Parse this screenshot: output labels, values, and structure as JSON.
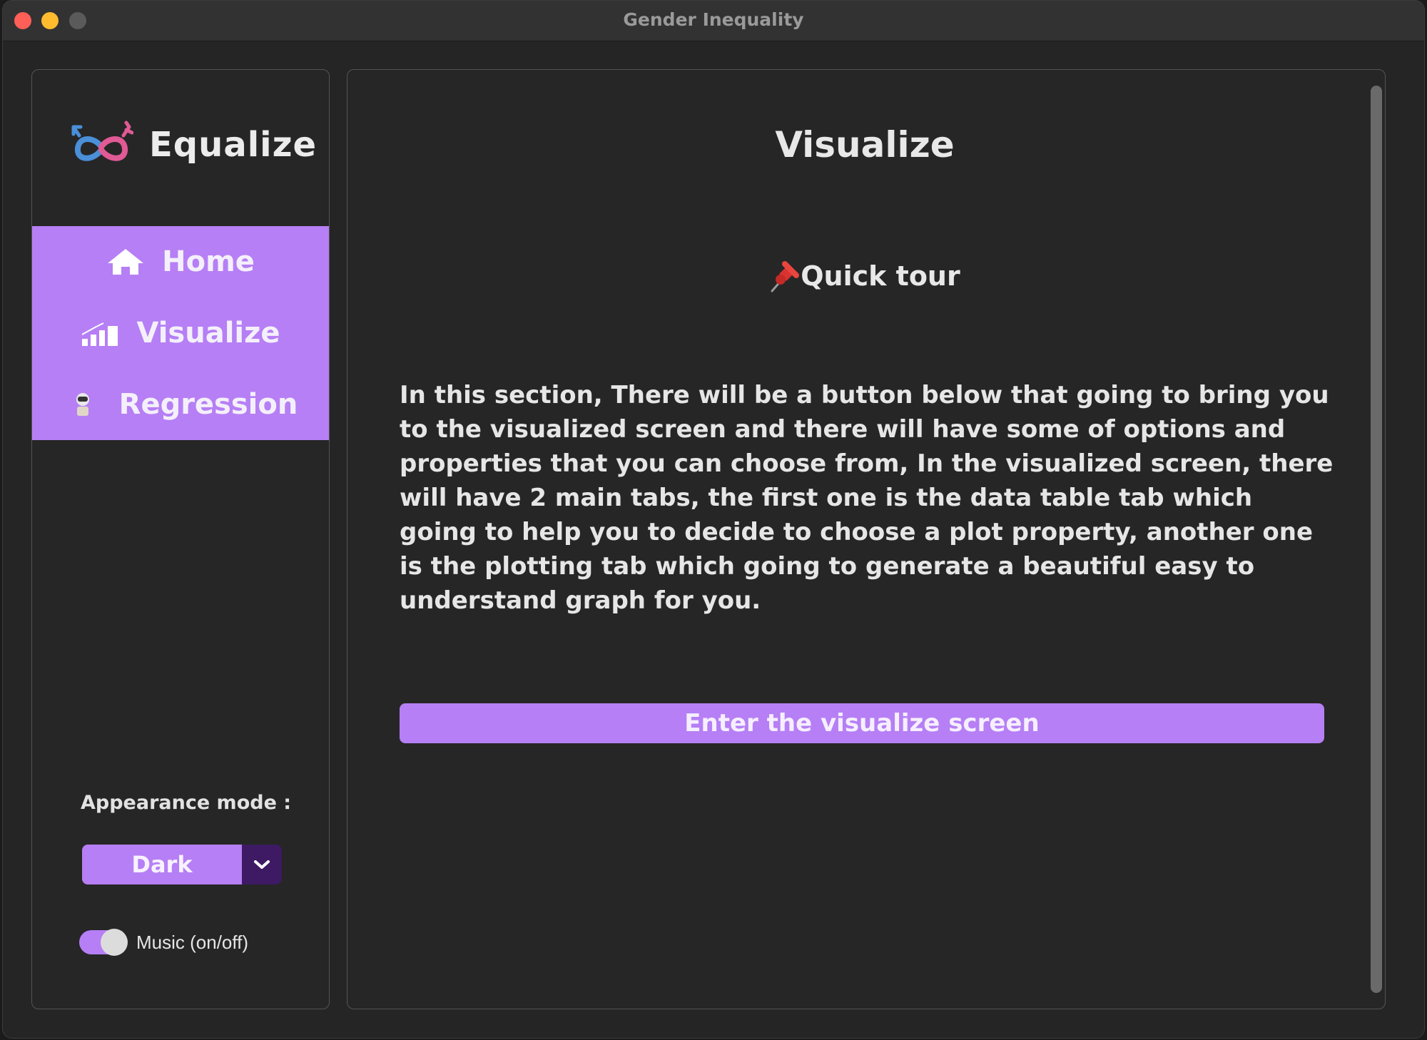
{
  "window": {
    "title": "Gender Inequality"
  },
  "sidebar": {
    "app_name": "Equalize",
    "logo_icon": "gender-infinity-icon",
    "nav": [
      {
        "label": "Home",
        "icon": "home-icon"
      },
      {
        "label": "Visualize",
        "icon": "bar-chart-icon"
      },
      {
        "label": "Regression",
        "icon": "robot-icon"
      }
    ],
    "appearance_label": "Appearance mode :",
    "appearance_value": "Dark",
    "music_label": "Music (on/off)",
    "music_on": true
  },
  "main": {
    "title": "Visualize",
    "tour_title": "Quick tour",
    "tour_icon": "pushpin-icon",
    "description": "In this section, There will be a button below that going to bring you to the visualized screen and there will have some of options and properties that you can choose from, In the visualized screen, there will have 2 main tabs, the first one is the data table tab which going to help you to decide to choose a plot property, another one is the plotting tab which going to generate a beautiful easy to understand graph for you.",
    "enter_button": "Enter the visualize screen"
  },
  "colors": {
    "accent": "#b67ff5",
    "dropdown_button": "#3d1a63",
    "background": "#262626"
  }
}
